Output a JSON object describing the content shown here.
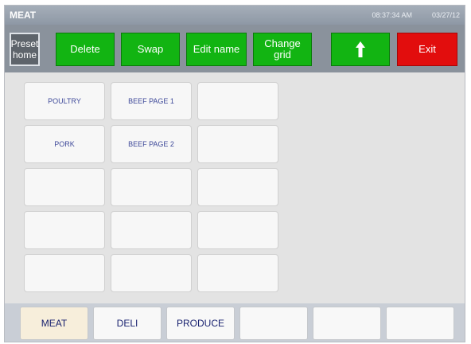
{
  "window": {
    "title": "MEAT",
    "time": "08:37:34 AM",
    "date": "03/27/12"
  },
  "toolbar": {
    "preset_line1": "Preset",
    "preset_line2": "home",
    "delete_label": "Delete",
    "swap_label": "Swap",
    "edit_name_label": "Edit name",
    "change_grid_line1": "Change",
    "change_grid_line2": "grid",
    "up_icon": "up-arrow-icon",
    "exit_label": "Exit"
  },
  "grid": {
    "columns": 3,
    "rows": 5,
    "items": [
      "POULTRY",
      "BEEF PAGE 1",
      "",
      "PORK",
      "BEEF PAGE 2",
      "",
      "",
      "",
      "",
      "",
      "",
      "",
      "",
      "",
      ""
    ]
  },
  "bottom_tabs": {
    "active_index": 0,
    "items": [
      "MEAT",
      "DELI",
      "PRODUCE",
      "",
      "",
      ""
    ]
  },
  "colors": {
    "green_button": "#12b412",
    "exit_button": "#e20d0d",
    "tile_text": "#3f4a9a",
    "active_tab": "#f7eedb"
  }
}
